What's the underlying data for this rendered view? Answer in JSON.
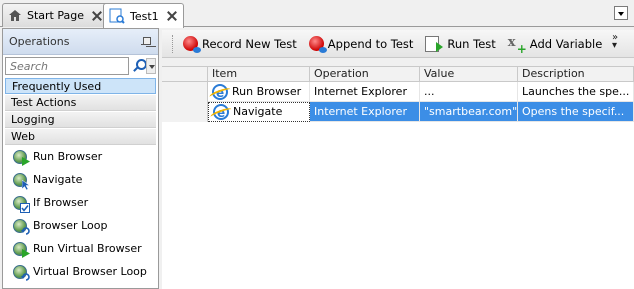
{
  "tabs": [
    {
      "label": "Start Page",
      "icon": "home-icon"
    },
    {
      "label": "Test1",
      "icon": "test-icon"
    }
  ],
  "left_panel": {
    "title": "Operations",
    "search_placeholder": "Search",
    "categories": [
      "Frequently Used",
      "Test Actions",
      "Logging",
      "Web"
    ],
    "operations": [
      {
        "label": "Run Browser",
        "icon": "run-browser-icon"
      },
      {
        "label": "Navigate",
        "icon": "navigate-icon"
      },
      {
        "label": "If Browser",
        "icon": "if-browser-icon"
      },
      {
        "label": "Browser Loop",
        "icon": "browser-loop-icon"
      },
      {
        "label": "Run Virtual Browser",
        "icon": "run-virtual-browser-icon"
      },
      {
        "label": "Virtual Browser Loop",
        "icon": "virtual-browser-loop-icon"
      }
    ]
  },
  "toolbar": {
    "record_label": "Record New Test",
    "append_label": "Append to Test",
    "run_label": "Run Test",
    "variable_label": "Add Variable"
  },
  "grid": {
    "columns": [
      "Item",
      "Operation",
      "Value",
      "Description"
    ],
    "rows": [
      {
        "item": "Run Browser",
        "operation": "Internet Explorer",
        "value": "...",
        "description": "Launches the spe..."
      },
      {
        "item": "Navigate",
        "operation": "Internet Explorer",
        "value": "\"smartbear.com\",...",
        "description": "Opens the specif..."
      }
    ]
  },
  "colors": {
    "selection": "#3c8ee6",
    "category_selected": "#cde4f9",
    "panel_header": "#cfdcee"
  }
}
